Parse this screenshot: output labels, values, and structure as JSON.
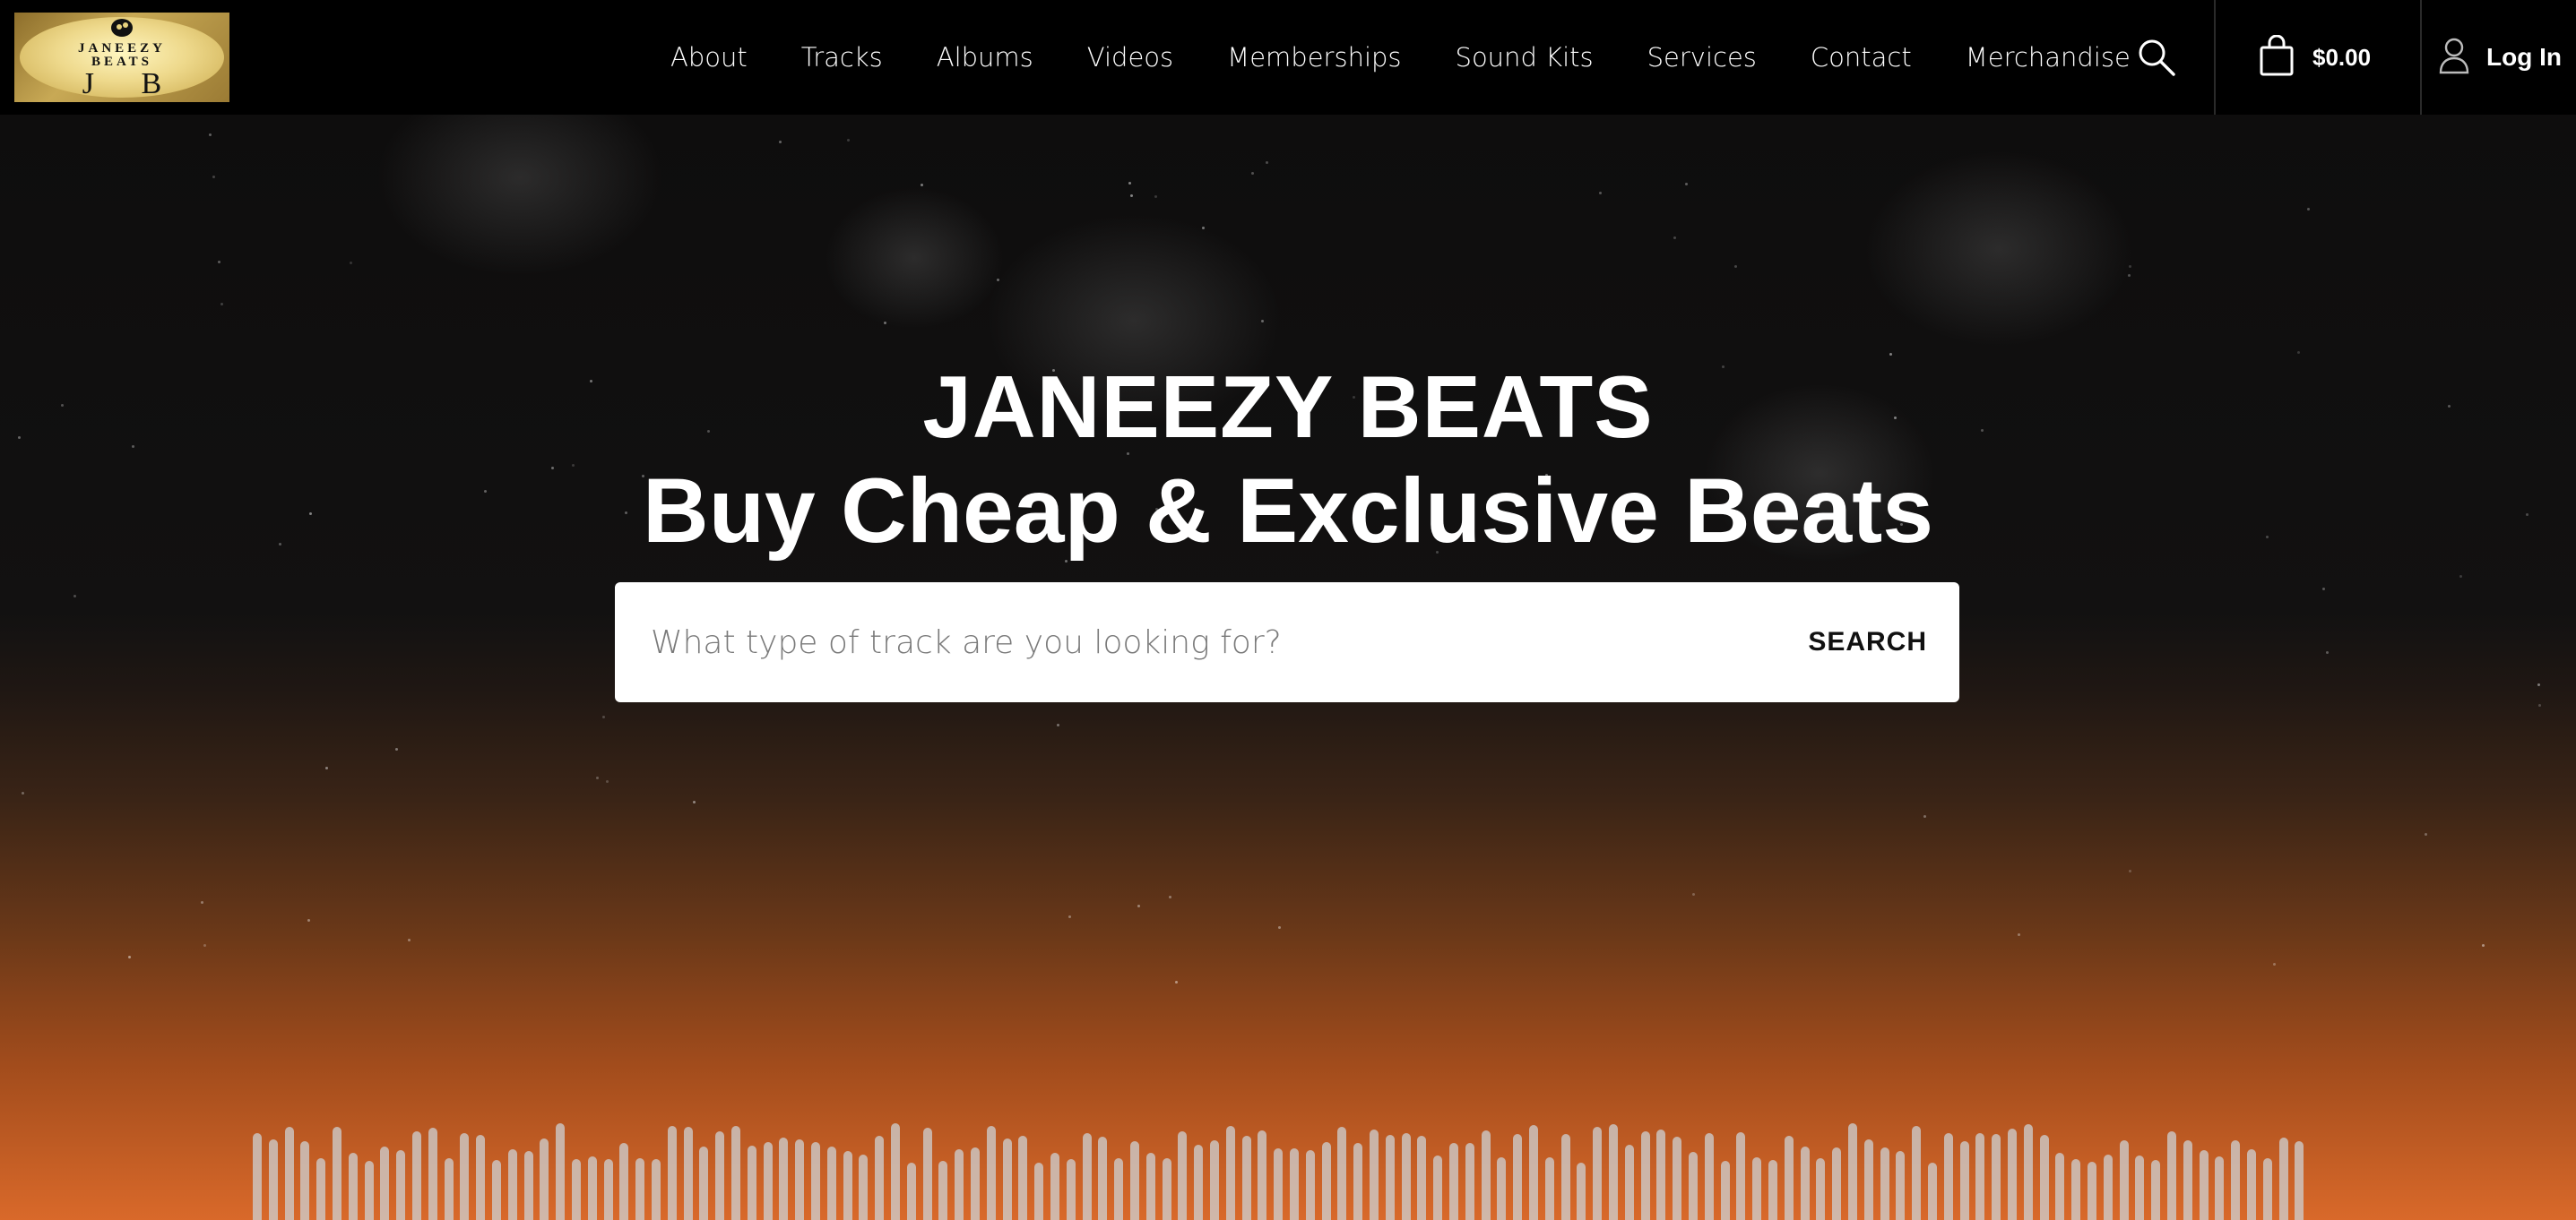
{
  "brand": {
    "logo_line1": "JANEEZY",
    "logo_line2": "BEATS",
    "logo_monogram": "J B",
    "logo_icon": "head-music-note-icon",
    "logo_colors": [
      "#c9a84a",
      "#fff6c0"
    ]
  },
  "nav": {
    "links": [
      "About",
      "Tracks",
      "Albums",
      "Videos",
      "Memberships",
      "Sound Kits",
      "Services",
      "Contact",
      "Merchandise"
    ],
    "search_icon": "search-icon",
    "cart_icon": "shopping-bag-icon",
    "cart_total": "$0.00",
    "login_icon": "user-icon",
    "login_label": "Log In"
  },
  "hero": {
    "title": "JANEEZY BEATS",
    "subtitle": "Buy Cheap & Exclusive Beats",
    "search_placeholder": "What type of track are you looking for?",
    "search_button": "SEARCH",
    "gradient_colors": [
      "#0e0d0d",
      "#3a2416",
      "#a24c1c",
      "#d9692a"
    ],
    "waveform_icon": "audio-waveform"
  }
}
